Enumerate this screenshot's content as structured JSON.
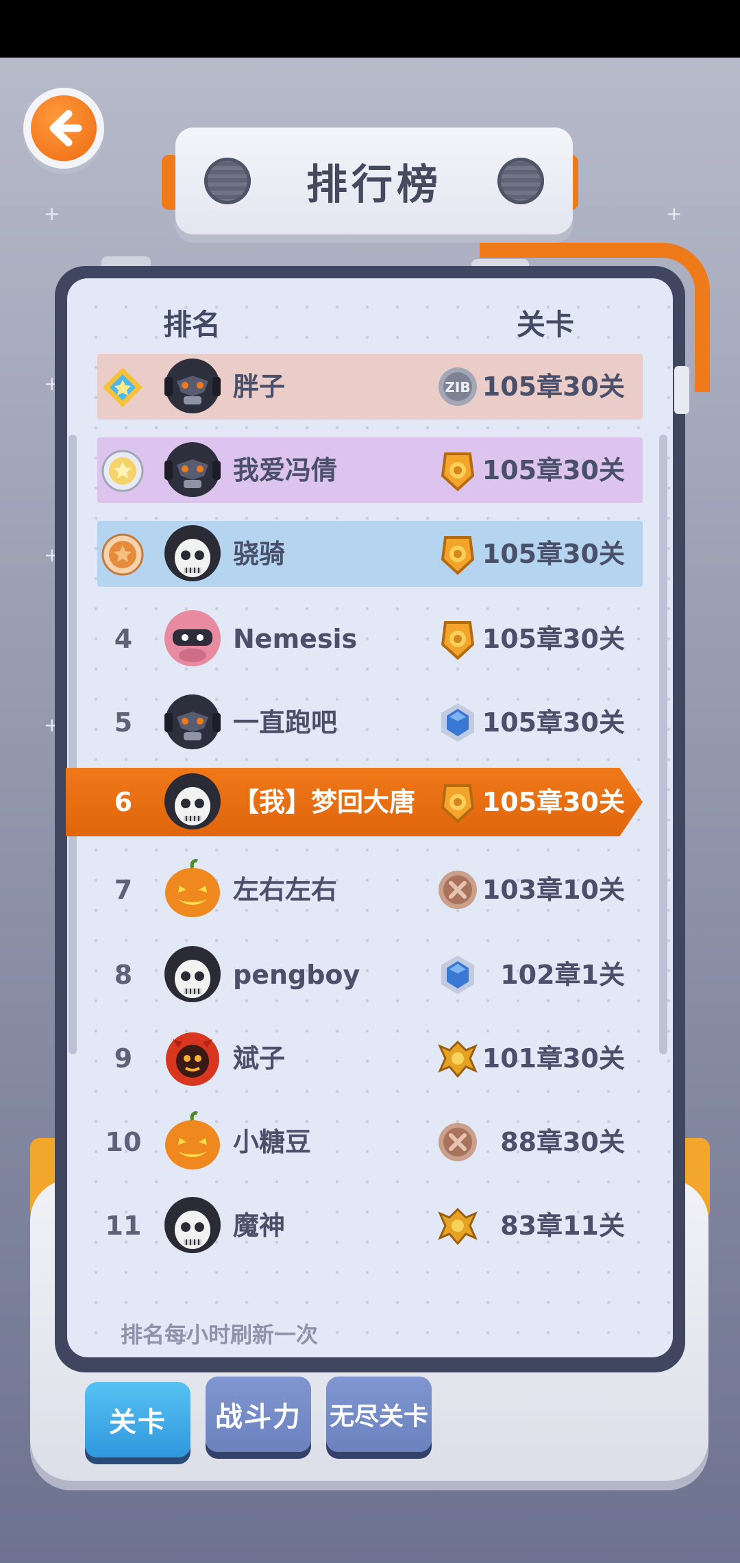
{
  "header": {
    "title": "排行榜"
  },
  "columns": {
    "rank": "排名",
    "level": "关卡"
  },
  "rows": [
    {
      "rank": "1",
      "medal": "diamond-medal",
      "avatar": "robot-mask",
      "name": "胖子",
      "tier": "zib-badge",
      "level": "105章30关",
      "bg": "#eaccc8"
    },
    {
      "rank": "2",
      "medal": "silver-medal",
      "avatar": "robot-mask",
      "name": "我爱冯倩",
      "tier": "gold-shield",
      "level": "105章30关",
      "bg": "#dcc4ee"
    },
    {
      "rank": "3",
      "medal": "bronze-medal",
      "avatar": "skull-hood",
      "name": "骁骑",
      "tier": "gold-shield",
      "level": "105章30关",
      "bg": "#b4d4ef"
    },
    {
      "rank": "4",
      "medal": "",
      "avatar": "pink-ninja",
      "name": "Nemesis",
      "tier": "gold-shield",
      "level": "105章30关",
      "bg": ""
    },
    {
      "rank": "5",
      "medal": "",
      "avatar": "robot-mask",
      "name": "一直跑吧",
      "tier": "blue-gem",
      "level": "105章30关",
      "bg": ""
    },
    {
      "rank": "6",
      "medal": "",
      "avatar": "skull-hood",
      "name": "【我】梦回大唐",
      "tier": "gold-shield",
      "level": "105章30关",
      "bg": "",
      "me": true
    },
    {
      "rank": "7",
      "medal": "",
      "avatar": "pumpkin",
      "name": "左右左右",
      "tier": "bronze-cross",
      "level": "103章10关",
      "bg": ""
    },
    {
      "rank": "8",
      "medal": "",
      "avatar": "skull-hood",
      "name": "pengboy",
      "tier": "blue-gem",
      "level": "102章1关",
      "bg": ""
    },
    {
      "rank": "9",
      "medal": "",
      "avatar": "red-devil",
      "name": "斌子",
      "tier": "gold-wings",
      "level": "101章30关",
      "bg": ""
    },
    {
      "rank": "10",
      "medal": "",
      "avatar": "pumpkin",
      "name": "小糖豆",
      "tier": "bronze-cross",
      "level": "88章30关",
      "bg": ""
    },
    {
      "rank": "11",
      "medal": "",
      "avatar": "skull-hood",
      "name": "魔神",
      "tier": "gold-wings",
      "level": "83章11关",
      "bg": ""
    }
  ],
  "footnote": "排名每小时刷新一次",
  "tabs": [
    {
      "label": "关卡",
      "active": true
    },
    {
      "label": "战斗力",
      "active": false
    },
    {
      "label": "无尽关卡",
      "active": false
    }
  ],
  "colors": {
    "accent": "#ef7a1a",
    "me_band": "#e8700f",
    "tab_active": "#3fa8e8",
    "tab_inactive": "#7088c4"
  },
  "icons": {
    "back": "back-arrow-icon"
  }
}
